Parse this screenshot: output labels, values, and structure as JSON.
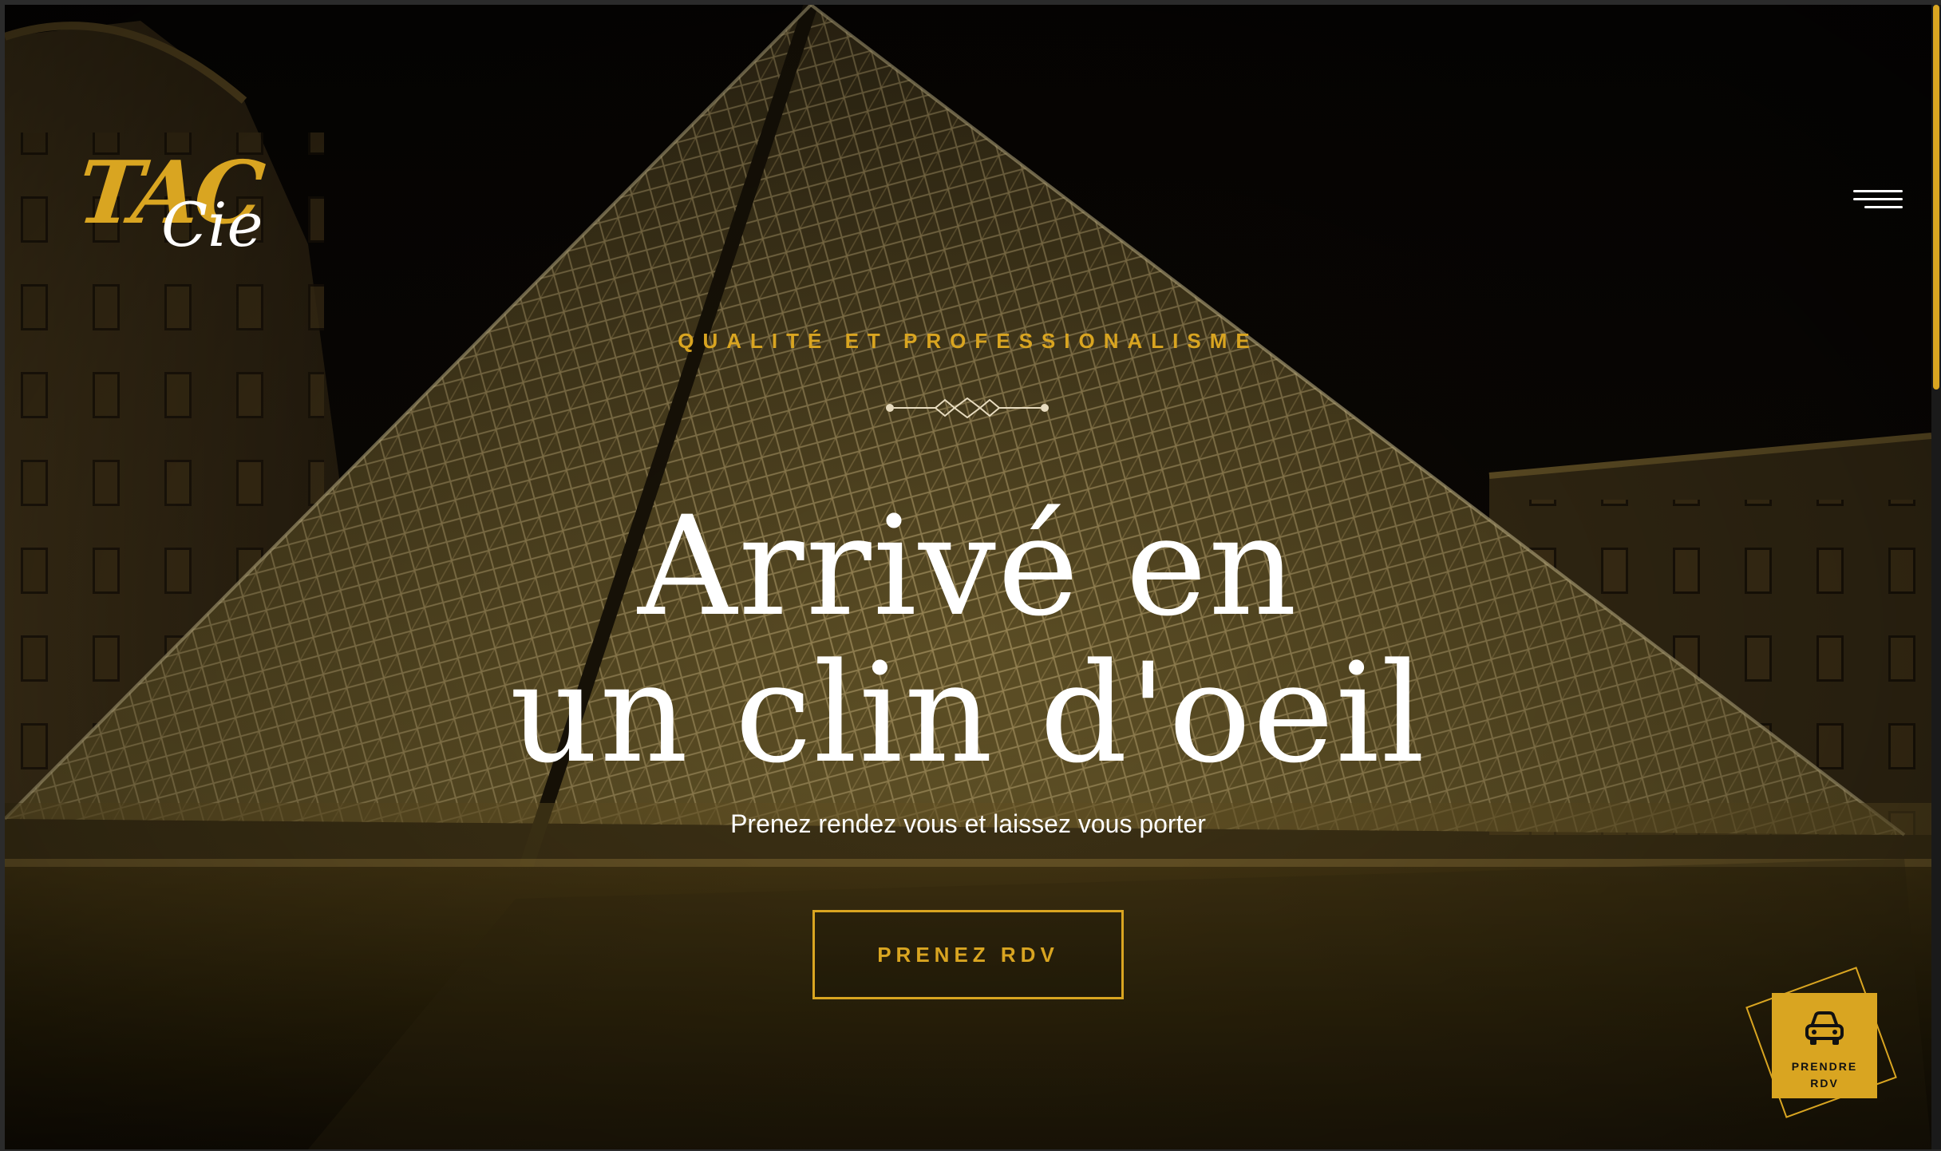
{
  "brand": {
    "logo_main": "TAC",
    "logo_sub": "Cie"
  },
  "header": {
    "menu_icon": "hamburger-icon"
  },
  "hero": {
    "eyebrow": "QUALITÉ ET PROFESSIONALISME",
    "headline_line1": "Arrivé en",
    "headline_line2": "un clin d'oeil",
    "subtitle": "Prenez rendez vous et laissez vous porter",
    "cta_label": "PRENEZ RDV"
  },
  "floating_widget": {
    "icon": "car-icon",
    "label_line1": "PRENDRE",
    "label_line2": "RDV"
  },
  "colors": {
    "accent": "#d9a521",
    "text": "#ffffff",
    "background": "#0a0805"
  }
}
